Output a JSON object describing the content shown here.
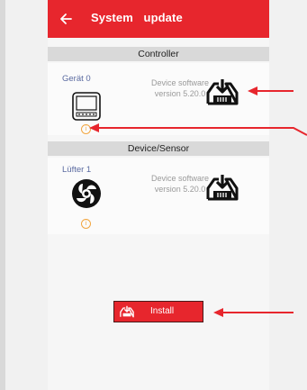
{
  "header": {
    "title": "System update",
    "back_icon": "arrow-left-icon"
  },
  "sections": [
    {
      "title": "Controller",
      "device": {
        "name": "Gerät 0",
        "version_text": "Device software version 5.20.0",
        "icon": "controller-display-icon"
      }
    },
    {
      "title": "Device/Sensor",
      "device": {
        "name": "Lüfter 1",
        "version_text": "Device software version 5.20.0",
        "icon": "fan-icon"
      }
    }
  ],
  "install": {
    "label": "Install",
    "icon": "download-icon"
  },
  "colors": {
    "accent": "#e7262d",
    "info": "#f2a640",
    "annotation_arrow": "#e7262d"
  }
}
